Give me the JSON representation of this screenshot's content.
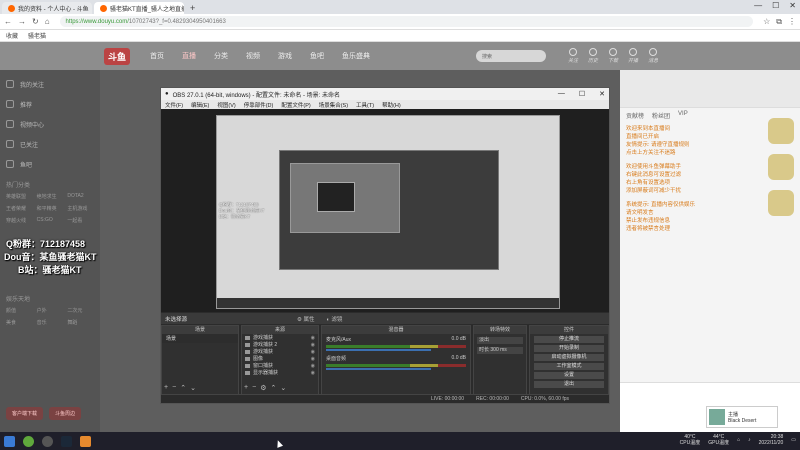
{
  "browser": {
    "tabs": [
      {
        "label": "我的资料 - 个人中心 - 斗鱼",
        "active": false
      },
      {
        "label": "骚老猫KT直播_骚人之地直播",
        "active": true
      }
    ],
    "url_secure": "https://www.douyu.com/",
    "url_rest": "10702743?_f=0.4829304950401663",
    "bookmarks": [
      "收藏",
      "骚老猫"
    ]
  },
  "douyu": {
    "logo": "斗鱼",
    "nav": [
      "首页",
      "直播",
      "分类",
      "视频",
      "游戏",
      "鱼吧",
      "鱼乐盛典"
    ],
    "search_placeholder": "搜索",
    "header_icons": [
      "关注",
      "历史",
      "下载",
      "开播",
      "消息"
    ],
    "sidebar": {
      "items": [
        "我的关注",
        "推荐",
        "视频中心",
        "已关注",
        "鱼吧"
      ],
      "section1_title": "热门分类",
      "grid1": [
        "英雄联盟",
        "绝地求生",
        "DOTA2",
        "王者荣耀",
        "和平精英",
        "主机游戏",
        "穿越火线",
        "CS:GO",
        "一起看"
      ],
      "section2_title": "娱乐天地",
      "grid2": [
        "颜值",
        "户外",
        "二次元",
        "美食",
        "音乐",
        "舞蹈"
      ],
      "buttons": [
        "客户端下载",
        "斗鱼周边"
      ]
    },
    "chat": {
      "tabs": [
        "贡献榜",
        "粉丝团",
        "VIP"
      ],
      "lines": [
        "欢迎来到本直播间",
        "直播间已开启",
        "友情提示: 请遵守直播规则",
        "点击上方关注不迷路"
      ],
      "lines2": [
        "欢迎使用斗鱼弹幕助手",
        "右键此消息可设置过滤",
        "右上角有设置选项",
        "添加屏蔽词可减少干扰"
      ],
      "lines3": [
        "系统提示: 直播内容仅供娱乐",
        "请文明发言",
        "禁止发布违规信息",
        "违者将被禁言处理"
      ],
      "user_name": "主播",
      "user_sub": "Black Desert"
    }
  },
  "overlay": {
    "line1": "Q粉群：712187458",
    "line2": "Dou音：某鱼骚老猫KT",
    "line3": "B站：骚老猫KT"
  },
  "obs": {
    "title": "OBS 27.0.1 (64-bit, windows) - 配置文件: 未命名 - 场景: 未命名",
    "menu": [
      "文件(F)",
      "编辑(E)",
      "视图(V)",
      "停靠部件(D)",
      "配置文件(P)",
      "场景集合(S)",
      "工具(T)",
      "帮助(H)"
    ],
    "scene_bar": "未选择源",
    "scene_bar_props": "属性",
    "scene_bar_filters": "滤镜",
    "docks": {
      "scenes_title": "场景",
      "sources_title": "来源",
      "mixer_title": "混音器",
      "transitions_title": "转场特效",
      "controls_title": "控件"
    },
    "scenes": [
      "场景"
    ],
    "sources": [
      "游戏捕获",
      "游戏捕获 2",
      "游戏捕获",
      "图像",
      "窗口捕获",
      "显示器捕获"
    ],
    "mixer": [
      {
        "label": "麦克风/Aux",
        "db": "0.0 dB"
      },
      {
        "label": "桌面音频",
        "db": "0.0 dB"
      }
    ],
    "transitions": {
      "type": "淡出",
      "duration_label": "时长",
      "duration": "300 ms"
    },
    "controls": [
      "停止推流",
      "开始录制",
      "启动虚拟摄像机",
      "工作室模式",
      "设置",
      "退出"
    ],
    "status": {
      "live": "LIVE: 00:00:00",
      "rec": "REC: 00:00:00",
      "cpu": "CPU: 0.0%, 60.00 fps"
    }
  },
  "nested_overlay": [
    "Q粉群：712187458",
    "Dou音：某鱼骚老猫KT",
    "B站：骚老猫KT"
  ],
  "taskbar": {
    "temp_cpu": "40°C",
    "temp_cpu_label": "CPU温度",
    "temp_gpu": "44°C",
    "temp_gpu_label": "GPU温度",
    "time": "20:38",
    "date": "2022/11/20"
  }
}
